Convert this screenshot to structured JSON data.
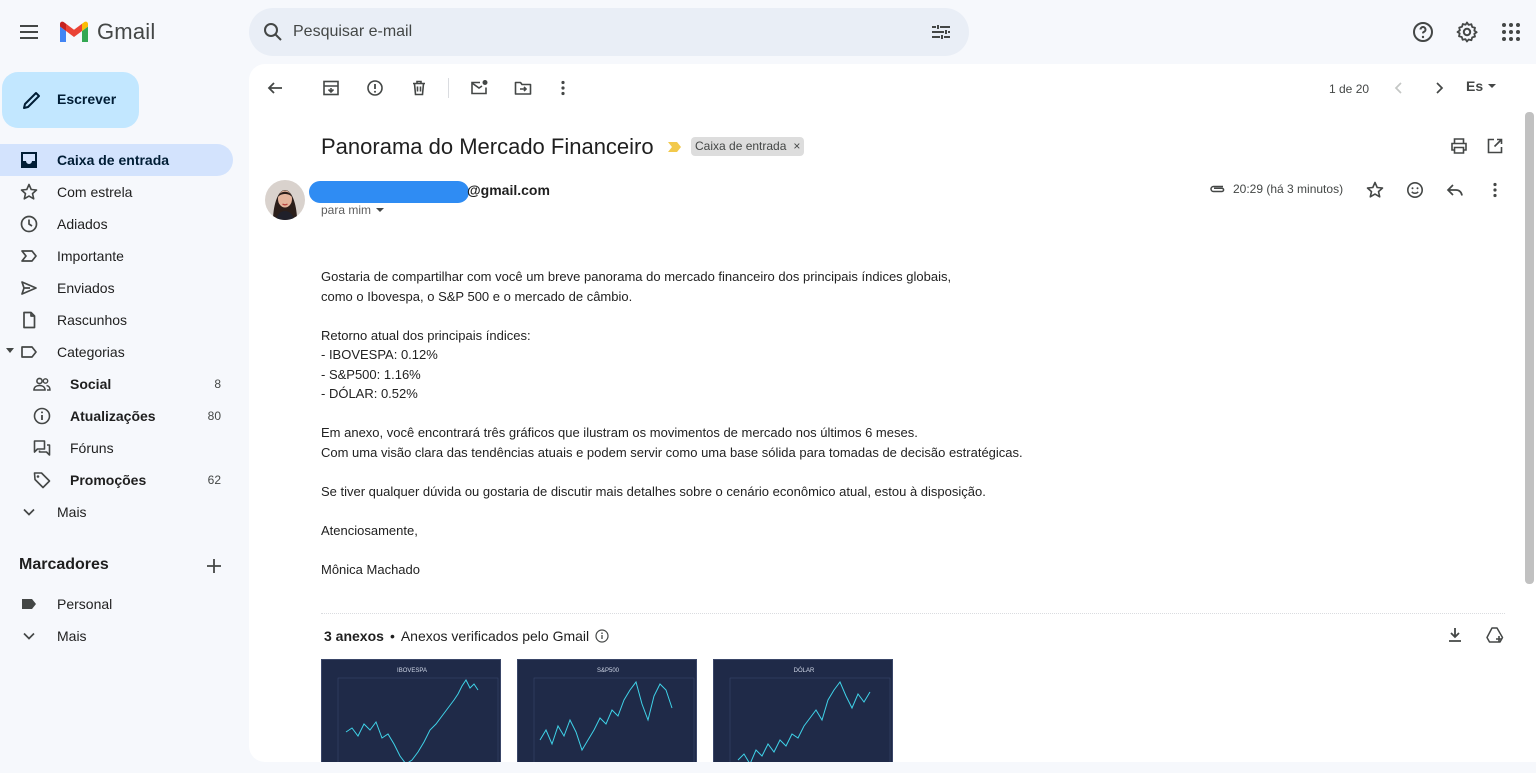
{
  "app": {
    "name": "Gmail",
    "search_placeholder": "Pesquisar e-mail"
  },
  "sidebar": {
    "compose_label": "Escrever",
    "items": [
      {
        "label": "Caixa de entrada",
        "icon": "inbox-icon",
        "active": true
      },
      {
        "label": "Com estrela",
        "icon": "star-icon"
      },
      {
        "label": "Adiados",
        "icon": "clock-icon"
      },
      {
        "label": "Importante",
        "icon": "label-important-icon"
      },
      {
        "label": "Enviados",
        "icon": "send-icon"
      },
      {
        "label": "Rascunhos",
        "icon": "draft-icon"
      },
      {
        "label": "Categorias",
        "icon": "label-icon"
      }
    ],
    "categories": [
      {
        "label": "Social",
        "count": "8",
        "icon": "people-icon"
      },
      {
        "label": "Atualizações",
        "count": "80",
        "icon": "info-icon"
      },
      {
        "label": "Fóruns",
        "count": "",
        "icon": "forum-icon"
      },
      {
        "label": "Promoções",
        "count": "62",
        "icon": "tag-icon"
      }
    ],
    "more_label": "Mais",
    "labels_heading": "Marcadores",
    "labels": [
      {
        "label": "Personal",
        "icon": "label-filled-icon"
      }
    ],
    "labels_more": "Mais"
  },
  "toolbar": {
    "pager": "1 de 20",
    "language": "Es"
  },
  "email": {
    "subject": "Panorama do Mercado Financeiro",
    "label_chip": "Caixa de entrada",
    "label_chip_close": "×",
    "sender_email": "@gmail.com",
    "to": "para mim",
    "time": "20:29 (há 3 minutos)",
    "body": {
      "p1_l1": "Gostaria de compartilhar com você um breve panorama do mercado financeiro dos principais índices globais,",
      "p1_l2": "como o Ibovespa, o S&P 500 e o mercado de câmbio.",
      "p2_l1": "Retorno atual dos principais índices:",
      "p2_l2": "- IBOVESPA: 0.12%",
      "p2_l3": "- S&P500: 1.16%",
      "p2_l4": "- DÓLAR: 0.52%",
      "p3_l1": "Em anexo, você encontrará três gráficos que ilustram os movimentos de mercado nos últimos 6 meses.",
      "p3_l2": "Com uma visão clara das tendências atuais e podem servir como uma base sólida para tomadas de decisão estratégicas.",
      "p4": "Se tiver qualquer dúvida ou gostaria de discutir mais detalhes sobre o cenário econômico atual, estou à disposição.",
      "closing": "Atenciosamente,",
      "signature": "Mônica Machado"
    }
  },
  "attachments": {
    "count_label": "3 anexos",
    "separator": "•",
    "verified_label": "Anexos verificados pelo Gmail",
    "items": [
      {
        "title": "IBOVESPA"
      },
      {
        "title": "S&P500"
      },
      {
        "title": "DÓLAR"
      }
    ]
  },
  "colors": {
    "accent": "#0b57d0",
    "compose_bg": "#c2e7ff",
    "active_nav": "#d3e3fd",
    "chart_bg": "#1f2a48",
    "chart_line": "#3fd2e8",
    "redaction": "#2f8cf3"
  }
}
